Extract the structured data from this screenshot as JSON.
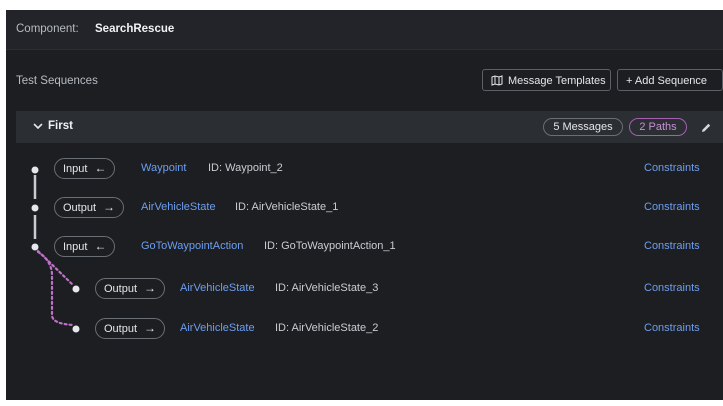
{
  "component": {
    "label": "Component:",
    "name": "SearchRescue"
  },
  "test_sequences": {
    "title": "Test Sequences",
    "buttons": {
      "message_templates": "Message Templates",
      "add_sequence": "+ Add Sequence"
    }
  },
  "sequence": {
    "name": "First",
    "messages_badge": "5 Messages",
    "paths_badge": "2 Paths",
    "rows": [
      {
        "direction": "Input",
        "arrow": "←",
        "message": "Waypoint",
        "id": "ID: Waypoint_2",
        "constraints": "Constraints"
      },
      {
        "direction": "Output",
        "arrow": "→",
        "message": "AirVehicleState",
        "id": "ID: AirVehicleState_1",
        "constraints": "Constraints"
      },
      {
        "direction": "Input",
        "arrow": "←",
        "message": "GoToWaypointAction",
        "id": "ID: GoToWaypointAction_1",
        "constraints": "Constraints"
      },
      {
        "direction": "Output",
        "arrow": "→",
        "message": "AirVehicleState",
        "id": "ID: AirVehicleState_3",
        "constraints": "Constraints"
      },
      {
        "direction": "Output",
        "arrow": "→",
        "message": "AirVehicleState",
        "id": "ID: AirVehicleState_2",
        "constraints": "Constraints"
      }
    ]
  },
  "colors": {
    "background": "#1c1e21",
    "link": "#6e9ef0",
    "path_branch": "#c070c8"
  },
  "icons": {
    "message_templates": "map-icon",
    "collapse": "chevron-down-icon",
    "edit": "pencil-icon"
  }
}
